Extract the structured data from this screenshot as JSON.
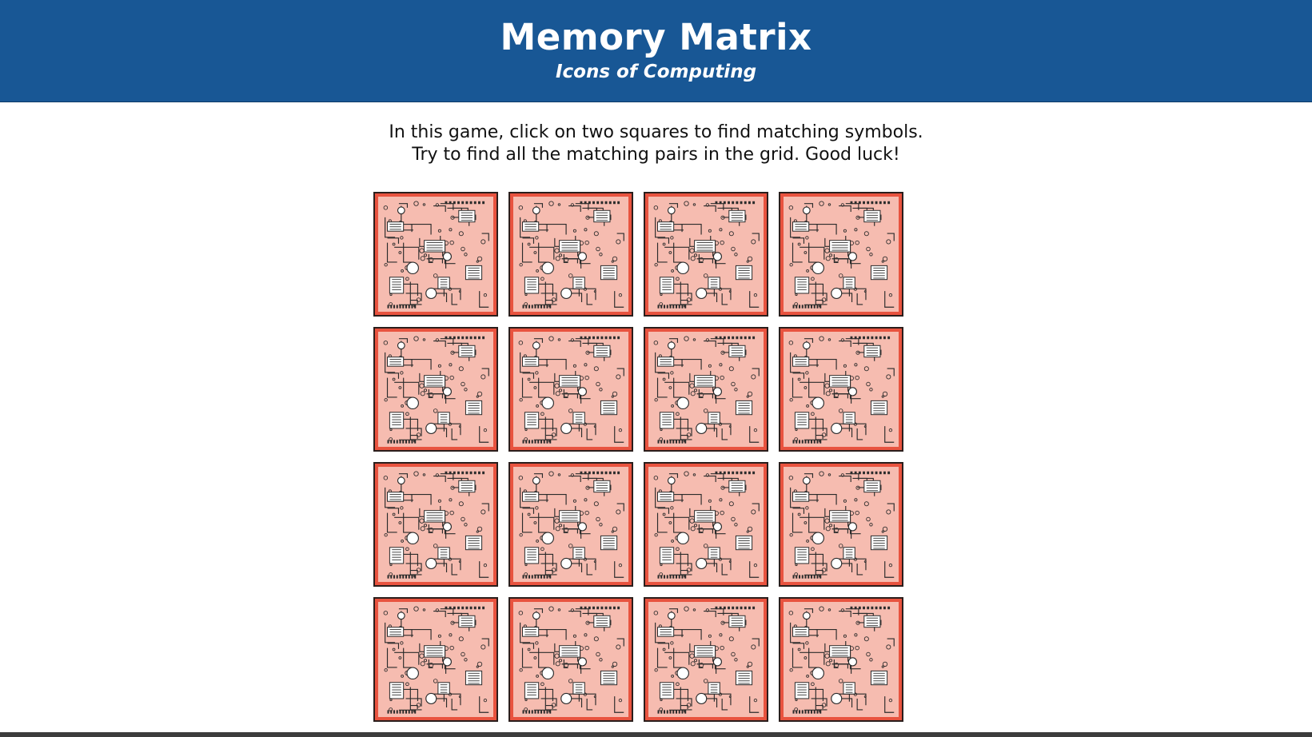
{
  "header": {
    "title": "Memory Matrix",
    "subtitle": "Icons of Computing"
  },
  "instructions": {
    "line1": "In this game, click on two squares to find matching symbols.",
    "line2": "Try to find all the matching pairs in the grid. Good luck!"
  },
  "colors": {
    "header_bg": "#185795",
    "card_border": "#e8533f",
    "card_face": "#f6bcb0",
    "circuit": "#2b2b2b"
  },
  "board": {
    "rows": 4,
    "columns": 4,
    "card_state": "face-down",
    "card_back_icon": "circuit-board-icon"
  }
}
